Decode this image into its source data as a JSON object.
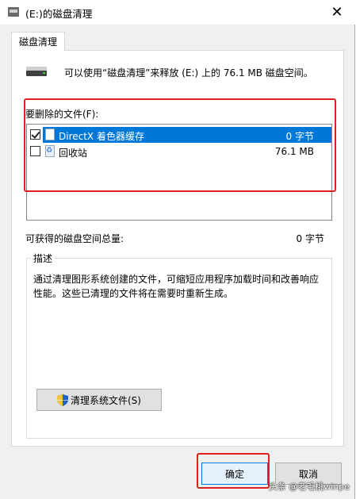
{
  "window": {
    "title": "(E:)的磁盘清理",
    "close_glyph": "✕"
  },
  "tab": {
    "label": "磁盘清理"
  },
  "header": {
    "text": "可以使用“磁盘清理”来释放 (E:) 上的 76.1 MB 磁盘空间。"
  },
  "files": {
    "label": "要删除的文件(F):",
    "items": [
      {
        "name": "DirectX 着色器缓存",
        "size": "0 字节",
        "checked": true,
        "selected": true,
        "icon": "file-icon"
      },
      {
        "name": "回收站",
        "size": "76.1 MB",
        "checked": false,
        "selected": false,
        "icon": "recycle-bin-icon"
      }
    ]
  },
  "gain": {
    "label": "可获得的磁盘空间总量:",
    "value": "0 字节"
  },
  "description": {
    "legend": "描述",
    "text": "通过清理图形系统创建的文件，可缩短应用程序加载时间和改善响应性能。这些已清理的文件将在需要时重新生成。"
  },
  "buttons": {
    "cleanup": "清理系统文件(S)",
    "ok": "确定",
    "cancel": "取消"
  },
  "watermark": "头条 @老毛桃winpe",
  "colors": {
    "selection": "#0078d7",
    "highlight_box": "#e02020"
  }
}
